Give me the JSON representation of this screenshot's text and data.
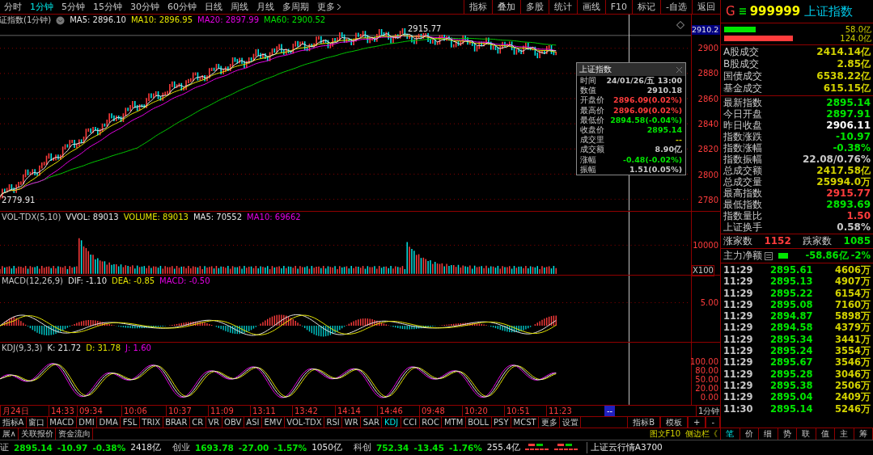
{
  "period_tabs": [
    {
      "label": "分时",
      "selected": false
    },
    {
      "label": "1分钟",
      "selected": true
    },
    {
      "label": "5分钟",
      "selected": false
    },
    {
      "label": "15分钟",
      "selected": false
    },
    {
      "label": "30分钟",
      "selected": false
    },
    {
      "label": "60分钟",
      "selected": false
    },
    {
      "label": "日线",
      "selected": false
    },
    {
      "label": "周线",
      "selected": false
    },
    {
      "label": "月线",
      "selected": false
    },
    {
      "label": "多周期",
      "selected": false
    },
    {
      "label": "更多",
      "selected": false
    }
  ],
  "toolbar_buttons": [
    "指标",
    "叠加",
    "多股",
    "统计",
    "画线",
    "F10",
    "标记",
    "-自选",
    "返回"
  ],
  "chart": {
    "title": "证指数(1分钟)",
    "ma": [
      {
        "label": "MA5: 2896.10",
        "color": "#e6e6e6"
      },
      {
        "label": "MA10: 2896.95",
        "color": "#e6e600"
      },
      {
        "label": "MA20: 2897.99",
        "color": "#e600e6"
      },
      {
        "label": "MA60: 2900.52",
        "color": "#00e600"
      }
    ],
    "price_tag": "2910.2",
    "y_labels": [
      "2900",
      "2880",
      "2860",
      "2840",
      "2820",
      "2800",
      "2780"
    ],
    "high_label": "2915.77",
    "low_label": "2779.91"
  },
  "tooltip": {
    "title": "上证指数",
    "rows": [
      {
        "label": "时间",
        "value": "24/01/26/五 13:00",
        "color": "#c8c8c8"
      },
      {
        "label": "数值",
        "value": "2910.18",
        "color": "#c8c8c8"
      },
      {
        "label": "开盘价",
        "value": "2896.09(0.02%)",
        "color": "#ff3c3c"
      },
      {
        "label": "最高价",
        "value": "2896.09(0.02%)",
        "color": "#ff3c3c"
      },
      {
        "label": "最低价",
        "value": "2894.58(-0.04%)",
        "color": "#00e600"
      },
      {
        "label": "收盘价",
        "value": "2895.14",
        "color": "#00e600"
      },
      {
        "label": "成交里",
        "value": "--",
        "color": "#d2d200"
      },
      {
        "label": "成交额",
        "value": "8.90亿",
        "color": "#c8c8c8"
      },
      {
        "label": "涨幅",
        "value": "-0.48(-0.02%)",
        "color": "#00e600"
      },
      {
        "label": "振幅",
        "value": "1.51(0.05%)",
        "color": "#c8c8c8"
      }
    ]
  },
  "volume": {
    "legend": [
      {
        "label": "VOL-TDX(5,10)",
        "color": "#c8c8c8"
      },
      {
        "label": "VVOL: 89013",
        "color": "#e6e6e6"
      },
      {
        "label": "VOLUME: 89013",
        "color": "#e6e600"
      },
      {
        "label": "MA5: 70552",
        "color": "#e6e6e6"
      },
      {
        "label": "MA10: 69662",
        "color": "#e600e6"
      }
    ],
    "y_labels": [
      "10000"
    ],
    "unit": "X100"
  },
  "macd": {
    "legend": [
      {
        "label": "MACD(12,26,9)",
        "color": "#c8c8c8"
      },
      {
        "label": "DIF: -1.10",
        "color": "#e6e6e6"
      },
      {
        "label": "DEA: -0.85",
        "color": "#e6e600"
      },
      {
        "label": "MACD: -0.50",
        "color": "#e600e6"
      }
    ],
    "y_labels": [
      "5.00"
    ]
  },
  "kdj": {
    "legend": [
      {
        "label": "KDJ(9,3,3)",
        "color": "#c8c8c8"
      },
      {
        "label": "K: 21.72",
        "color": "#e6e6e6"
      },
      {
        "label": "D: 31.78",
        "color": "#e6e600"
      },
      {
        "label": "J: 1.60",
        "color": "#e600e6"
      }
    ],
    "y_labels": [
      "100.00",
      "80.00",
      "50.00",
      "20.00",
      "0.00"
    ]
  },
  "time_axis": {
    "labels": [
      "月24日",
      "14:33",
      "09:34",
      "10:06",
      "10:37",
      "11:09",
      "13:11",
      "13:42",
      "14:14",
      "14:46",
      "09:48",
      "10:20",
      "10:51",
      "11:23"
    ],
    "cursor": "--",
    "period": "1分钟"
  },
  "indicator_tabs": [
    {
      "label": "指标A",
      "selected": false
    },
    {
      "label": "窗口",
      "selected": false
    },
    {
      "label": "MACD",
      "selected": false
    },
    {
      "label": "DMI",
      "selected": false
    },
    {
      "label": "DMA",
      "selected": false
    },
    {
      "label": "FSL",
      "selected": false
    },
    {
      "label": "TRIX",
      "selected": false
    },
    {
      "label": "BRAR",
      "selected": false
    },
    {
      "label": "CR",
      "selected": false
    },
    {
      "label": "VR",
      "selected": false
    },
    {
      "label": "OBV",
      "selected": false
    },
    {
      "label": "ASI",
      "selected": false
    },
    {
      "label": "EMV",
      "selected": false
    },
    {
      "label": "VOL-TDX",
      "selected": false
    },
    {
      "label": "RSI",
      "selected": false
    },
    {
      "label": "WR",
      "selected": false
    },
    {
      "label": "SAR",
      "selected": false
    },
    {
      "label": "KDJ",
      "selected": true
    },
    {
      "label": "CCI",
      "selected": false
    },
    {
      "label": "ROC",
      "selected": false
    },
    {
      "label": "MTM",
      "selected": false
    },
    {
      "label": "BOLL",
      "selected": false
    },
    {
      "label": "PSY",
      "selected": false
    },
    {
      "label": "MCST",
      "selected": false
    },
    {
      "label": "更多",
      "selected": false
    },
    {
      "label": "设置",
      "selected": false
    }
  ],
  "right_tabs": [
    "指标B",
    "模板",
    "+",
    "-"
  ],
  "extra_tabs": [
    "展∧",
    "关联报价",
    "资金流向"
  ],
  "side_links": [
    "图文F10",
    "侧边栏《"
  ],
  "quote": {
    "flag": "G",
    "code": "999999",
    "name": "上证指数",
    "bars": [
      {
        "value": "58.0亿",
        "color": "#00e600"
      },
      {
        "value": "124.0亿",
        "color": "#ff3c3c"
      }
    ]
  },
  "turnover": [
    {
      "label": "A股成交",
      "value": "2414.14亿",
      "color": "#d2d200"
    },
    {
      "label": "B股成交",
      "value": "2.85亿",
      "color": "#d2d200"
    },
    {
      "label": "国债成交",
      "value": "6538.22亿",
      "color": "#d2d200"
    },
    {
      "label": "基金成交",
      "value": "615.15亿",
      "color": "#d2d200"
    }
  ],
  "stats": [
    {
      "label": "最新指数",
      "value": "2895.14",
      "color": "#00e600"
    },
    {
      "label": "今日开盘",
      "value": "2897.91",
      "color": "#00e600"
    },
    {
      "label": "昨日收盘",
      "value": "2906.11",
      "color": "#ffffff"
    },
    {
      "label": "指数涨跌",
      "value": "-10.97",
      "color": "#00e600"
    },
    {
      "label": "指数涨幅",
      "value": "-0.38%",
      "color": "#00e600"
    },
    {
      "label": "指数振幅",
      "value": "22.08/0.76%",
      "color": "#c8c8c8"
    },
    {
      "label": "总成交额",
      "value": "2417.58亿",
      "color": "#d2d200"
    },
    {
      "label": "总成交量",
      "value": "25994.0万",
      "color": "#d2d200"
    },
    {
      "label": "最高指数",
      "value": "2915.77",
      "color": "#ff3c3c"
    },
    {
      "label": "最低指数",
      "value": "2893.69",
      "color": "#00e600"
    },
    {
      "label": "指数量比",
      "value": "1.50",
      "color": "#ff3c3c"
    },
    {
      "label": "上证换手",
      "value": "0.58%",
      "color": "#c8c8c8"
    }
  ],
  "breadth": {
    "up_label": "涨家数",
    "up": "1152",
    "down_label": "跌家数",
    "down": "1085"
  },
  "main_flow": {
    "label": "主力净额",
    "value": "-58.86亿",
    "pct": "-2%",
    "level": 0.35
  },
  "ticks": [
    {
      "time": "11:29",
      "price": "2895.61",
      "volume": "4606万"
    },
    {
      "time": "11:29",
      "price": "2895.13",
      "volume": "4907万"
    },
    {
      "time": "11:29",
      "price": "2895.22",
      "volume": "6154万"
    },
    {
      "time": "11:29",
      "price": "2895.08",
      "volume": "7160万"
    },
    {
      "time": "11:29",
      "price": "2894.87",
      "volume": "5898万"
    },
    {
      "time": "11:29",
      "price": "2894.58",
      "volume": "4379万"
    },
    {
      "time": "11:29",
      "price": "2895.34",
      "volume": "3441万"
    },
    {
      "time": "11:29",
      "price": "2895.24",
      "volume": "3554万"
    },
    {
      "time": "11:29",
      "price": "2895.67",
      "volume": "3546万"
    },
    {
      "time": "11:29",
      "price": "2895.28",
      "volume": "3046万"
    },
    {
      "time": "11:29",
      "price": "2895.38",
      "volume": "2506万"
    },
    {
      "time": "11:29",
      "price": "2895.04",
      "volume": "2409万"
    },
    {
      "time": "11:30",
      "price": "2895.14",
      "volume": "5246万"
    }
  ],
  "detail_tabs": [
    {
      "label": "笔",
      "selected": true
    },
    {
      "label": "价",
      "selected": false
    },
    {
      "label": "细",
      "selected": false
    },
    {
      "label": "势",
      "selected": false
    },
    {
      "label": "联",
      "selected": false
    },
    {
      "label": "值",
      "selected": false
    },
    {
      "label": "主",
      "selected": false
    },
    {
      "label": "筹",
      "selected": false
    }
  ],
  "status": [
    {
      "name": "证",
      "price": "2895.14",
      "change": "-10.97",
      "pct": "-0.38%",
      "amount": "2418亿"
    },
    {
      "name": "创业",
      "price": "1693.78",
      "change": "-27.00",
      "pct": "-1.57%",
      "amount": "1050亿"
    },
    {
      "name": "科创",
      "price": "752.34",
      "change": "-13.45",
      "pct": "-1.76%",
      "amount": "255.4亿"
    }
  ],
  "status_text": "上证云行情A3700"
}
